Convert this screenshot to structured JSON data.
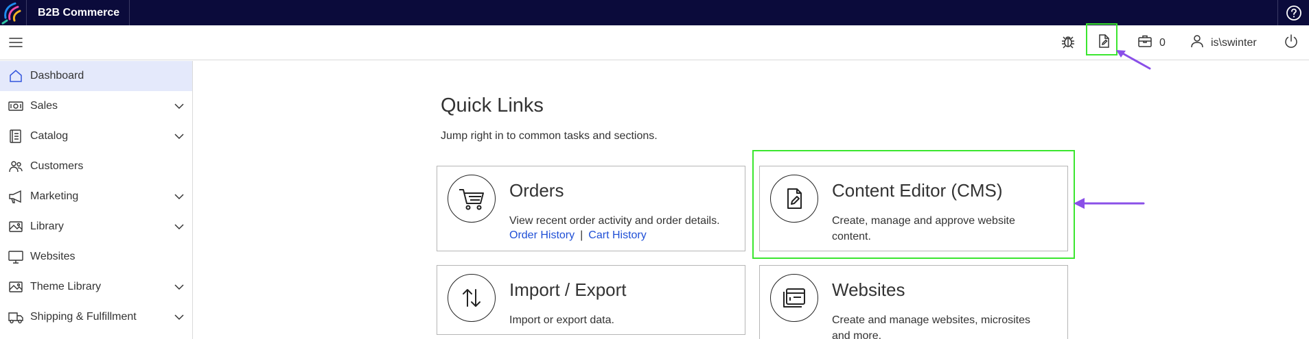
{
  "app": {
    "brand": "B2B Commerce",
    "colors": {
      "topbar": "#0b0b3b",
      "accent": "#1f4fd6",
      "active_nav": "#e4e9fb",
      "highlight": "#3ae62e",
      "arrow": "#8a4fe8"
    }
  },
  "header": {
    "cart_count": "0",
    "user_name": "is\\swinter",
    "icons": [
      "bug-icon",
      "document-edit-icon",
      "briefcase-icon",
      "user-icon",
      "power-icon"
    ]
  },
  "sidebar": {
    "items": [
      {
        "label": "Dashboard",
        "icon": "home-icon",
        "expandable": false,
        "active": true
      },
      {
        "label": "Sales",
        "icon": "money-icon",
        "expandable": true
      },
      {
        "label": "Catalog",
        "icon": "catalog-icon",
        "expandable": true
      },
      {
        "label": "Customers",
        "icon": "people-icon",
        "expandable": false
      },
      {
        "label": "Marketing",
        "icon": "megaphone-icon",
        "expandable": true
      },
      {
        "label": "Library",
        "icon": "image-icon",
        "expandable": true
      },
      {
        "label": "Websites",
        "icon": "monitor-icon",
        "expandable": false
      },
      {
        "label": "Theme Library",
        "icon": "image-icon",
        "expandable": true
      },
      {
        "label": "Shipping & Fulfillment",
        "icon": "truck-icon",
        "expandable": true
      }
    ]
  },
  "main": {
    "title": "Quick Links",
    "subtitle": "Jump right in to common tasks and sections.",
    "cards": [
      {
        "title": "Orders",
        "description": "View recent order activity and order details.",
        "links": [
          "Order History",
          "Cart History"
        ],
        "icon": "cart-icon"
      },
      {
        "title": "Content Editor (CMS)",
        "description": "Create, manage and approve website content.",
        "icon": "document-edit-icon"
      },
      {
        "title": "Import / Export",
        "description": "Import or export data.",
        "icon": "up-down-arrows-icon"
      },
      {
        "title": "Websites",
        "description": "Create and manage websites, microsites and more.",
        "icon": "browser-windows-icon"
      }
    ]
  }
}
